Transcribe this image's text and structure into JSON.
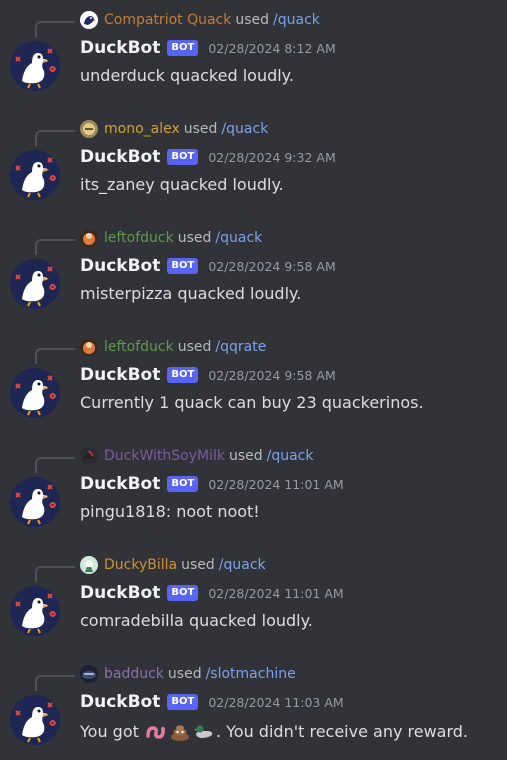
{
  "bot": {
    "name": "DuckBot",
    "tag": "BOT"
  },
  "messages": [
    {
      "reply_user": "Compatriot Quack",
      "reply_user_color": "#c27c3a",
      "used": "used",
      "command": "/quack",
      "timestamp": "02/28/2024 8:12 AM",
      "content": "underduck quacked loudly."
    },
    {
      "reply_user": "mono_alex",
      "reply_user_color": "#d1a02b",
      "used": "used",
      "command": "/quack",
      "timestamp": "02/28/2024 9:32 AM",
      "content": "its_zaney quacked loudly."
    },
    {
      "reply_user": "leftofduck",
      "reply_user_color": "#5c9a4b",
      "used": "used",
      "command": "/quack",
      "timestamp": "02/28/2024 9:58 AM",
      "content": "misterpizza quacked loudly."
    },
    {
      "reply_user": "leftofduck",
      "reply_user_color": "#5c9a4b",
      "used": "used",
      "command": "/qqrate",
      "timestamp": "02/28/2024 9:58 AM",
      "content": "Currently 1 quack can buy 23 quackerinos."
    },
    {
      "reply_user": "DuckWithSoyMilk",
      "reply_user_color": "#7f5a9e",
      "used": "used",
      "command": "/quack",
      "timestamp": "02/28/2024 11:01 AM",
      "content": "pingu1818: noot noot!"
    },
    {
      "reply_user": "DuckyBilla",
      "reply_user_color": "#c99335",
      "used": "used",
      "command": "/quack",
      "timestamp": "02/28/2024 11:01 AM",
      "content": "comradebilla quacked loudly."
    },
    {
      "reply_user": "badduck",
      "reply_user_color": "#8a6fb0",
      "used": "used",
      "command": "/slotmachine",
      "timestamp": "02/28/2024 11:03 AM",
      "content_prefix": "You got ",
      "content_suffix": ". You didn't receive any reward.",
      "emojis": [
        "worm-emoji",
        "poop-emoji",
        "duck-emoji"
      ]
    }
  ]
}
